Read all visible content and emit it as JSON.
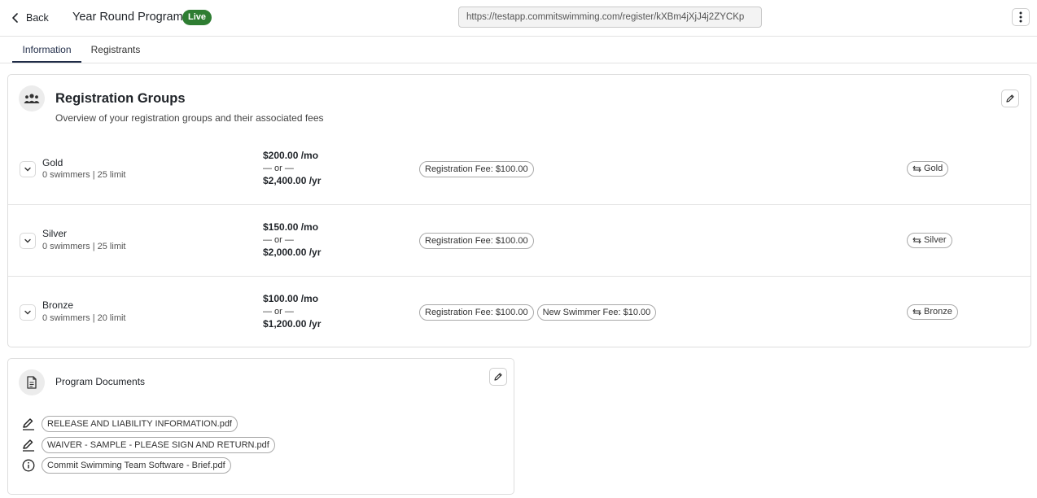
{
  "header": {
    "back_label": "Back",
    "title": "Year Round Program",
    "status_badge": "Live",
    "url": "https://testapp.commitswimming.com/register/kXBm4jXjJ4j2ZYCKp"
  },
  "tabs": [
    {
      "label": "Information",
      "active": true
    },
    {
      "label": "Registrants",
      "active": false
    }
  ],
  "registration_groups": {
    "title": "Registration Groups",
    "subtitle": "Overview of your registration groups and their associated fees",
    "groups": [
      {
        "name": "Gold",
        "meta": "0 swimmers | 25 limit",
        "monthly": "$200.00 /mo",
        "or": "— or —",
        "yearly": "$2,400.00 /yr",
        "fees": [
          "Registration Fee: $100.00"
        ],
        "tag": "Gold"
      },
      {
        "name": "Silver",
        "meta": "0 swimmers | 25 limit",
        "monthly": "$150.00 /mo",
        "or": "— or —",
        "yearly": "$2,000.00 /yr",
        "fees": [
          "Registration Fee: $100.00"
        ],
        "tag": "Silver"
      },
      {
        "name": "Bronze",
        "meta": "0 swimmers | 20 limit",
        "monthly": "$100.00 /mo",
        "or": "— or —",
        "yearly": "$1,200.00 /yr",
        "fees": [
          "Registration Fee: $100.00",
          "New Swimmer Fee: $10.00"
        ],
        "tag": "Bronze"
      }
    ]
  },
  "program_documents": {
    "title": "Program Documents",
    "documents": [
      {
        "name": "RELEASE AND LIABILITY INFORMATION.pdf",
        "icon": "signature-icon"
      },
      {
        "name": "WAIVER - SAMPLE - PLEASE SIGN AND RETURN.pdf",
        "icon": "signature-icon"
      },
      {
        "name": "Commit Swimming Team Software - Brief.pdf",
        "icon": "info-icon"
      }
    ]
  },
  "colors": {
    "live_badge": "#2e7d32",
    "tab_active": "#1f2b47"
  }
}
